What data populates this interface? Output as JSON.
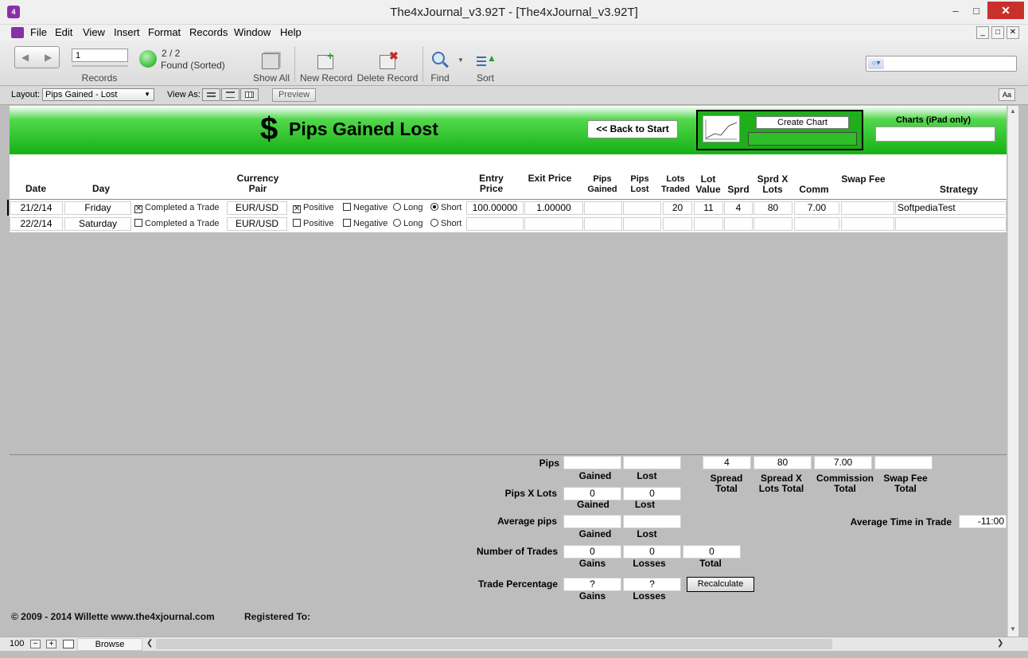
{
  "window": {
    "title": "The4xJournal_v3.92T - [The4xJournal_v3.92T]",
    "minimize": "–",
    "maximize": "□",
    "close": "✕"
  },
  "menu": [
    "File",
    "Edit",
    "View",
    "Insert",
    "Format",
    "Records",
    "Window",
    "Help"
  ],
  "toolbar": {
    "record_number": "1",
    "records_label": "Records",
    "found_count": "2 / 2",
    "found_status": "Found (Sorted)",
    "show_all": "Show All",
    "new_record": "New Record",
    "delete_record": "Delete Record",
    "find": "Find",
    "sort": "Sort",
    "search_placeholder": ""
  },
  "layoutbar": {
    "layout_label": "Layout:",
    "layout_value": "Pips Gained - Lost",
    "view_as_label": "View As:",
    "preview": "Preview",
    "text_size": "Aa"
  },
  "header": {
    "dollar": "$",
    "title": "Pips Gained Lost",
    "back_button": "<< Back to Start",
    "create_chart": "Create Chart",
    "charts_label": "Charts (iPad only)"
  },
  "columns": {
    "date": "Date",
    "day": "Day",
    "currency_pair": "Currency Pair",
    "entry_price": "Entry Price",
    "exit_price": "Exit Price",
    "pips_gained": "Pips Gained",
    "pips_lost": "Pips Lost",
    "lots_traded": "Lots Traded",
    "lot_value": "Lot Value",
    "sprd": "Sprd",
    "sprd_x_lots": "Sprd X Lots",
    "comm": "Comm",
    "swap_fee": "Swap Fee",
    "strategy": "Strategy"
  },
  "rows": [
    {
      "date": "21/2/14",
      "day": "Friday",
      "completed": true,
      "completed_label": "Completed a Trade",
      "pair": "EUR/USD",
      "positive": true,
      "negative": false,
      "direction": "Short",
      "entry": "100.00000",
      "exit": "1.00000",
      "pips_gained": "",
      "pips_lost": "",
      "lots": "20",
      "lot_value": "11",
      "sprd": "4",
      "sprd_lots": "80",
      "comm": "7.00",
      "swap": "",
      "strategy": "SoftpediaTest"
    },
    {
      "date": "22/2/14",
      "day": "Saturday",
      "completed": false,
      "completed_label": "Completed a Trade",
      "pair": "EUR/USD",
      "positive": false,
      "negative": false,
      "direction": "",
      "entry": "",
      "exit": "",
      "pips_gained": "",
      "pips_lost": "",
      "lots": "",
      "lot_value": "",
      "sprd": "",
      "sprd_lots": "",
      "comm": "",
      "swap": "",
      "strategy": ""
    }
  ],
  "options": {
    "positive": "Positive",
    "negative": "Negative",
    "long": "Long",
    "short": "Short"
  },
  "summary": {
    "pips_label": "Pips",
    "pips_gained": "",
    "pips_lost": "",
    "gained": "Gained",
    "lost": "Lost",
    "pips_x_lots_label": "Pips X Lots",
    "pxl_gained": "0",
    "pxl_lost": "0",
    "average_pips_label": "Average pips",
    "avg_gained": "",
    "avg_lost": "",
    "number_of_trades_label": "Number of Trades",
    "trades_gains": "0",
    "trades_losses": "0",
    "trades_total": "0",
    "gains": "Gains",
    "losses": "Losses",
    "total": "Total",
    "trade_percentage_label": "Trade Percentage",
    "pct_gains": "?",
    "pct_losses": "?",
    "recalculate": "Recalculate",
    "spread_total": "4",
    "spread_lots_total": "80",
    "commission_total": "7.00",
    "swap_total": "",
    "spread_total_label": "Spread Total",
    "spread_lots_total_label": "Spread X Lots Total",
    "commission_total_label": "Commission Total",
    "swap_total_label": "Swap Fee Total",
    "avg_time_label": "Average Time in Trade",
    "avg_time_value": "-11:00"
  },
  "footer": {
    "copyright": "© 2009 - 2014 Willette www.the4xjournal.com",
    "registered": "Registered To:"
  },
  "status": {
    "zoom": "100",
    "mode": "Browse"
  },
  "colors": {
    "header_green": "#15b114",
    "found_green": "#4cc44c",
    "close_red": "#c9302c"
  }
}
